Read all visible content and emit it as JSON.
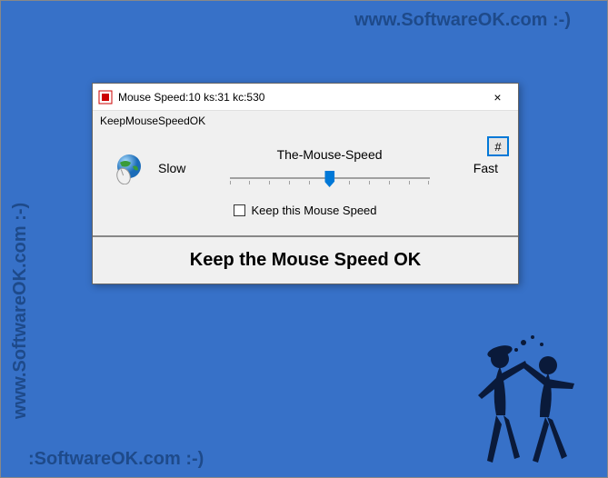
{
  "watermark": {
    "top": "www.SoftwareOK.com :-)",
    "left": "www.SoftwareOK.com :-)",
    "bottom": ":SoftwareOK.com :-)"
  },
  "window": {
    "title": "Mouse Speed:10 ks:31 kc:530",
    "close_symbol": "×"
  },
  "menu": {
    "item": "KeepMouseSpeedOK"
  },
  "hash_button": {
    "label": "#"
  },
  "slider": {
    "title": "The-Mouse-Speed",
    "slow_label": "Slow",
    "fast_label": "Fast",
    "value": 10,
    "min": 1,
    "max": 20
  },
  "checkbox": {
    "label": "Keep this Mouse Speed",
    "checked": false
  },
  "footer": {
    "text": "Keep the Mouse Speed OK"
  }
}
